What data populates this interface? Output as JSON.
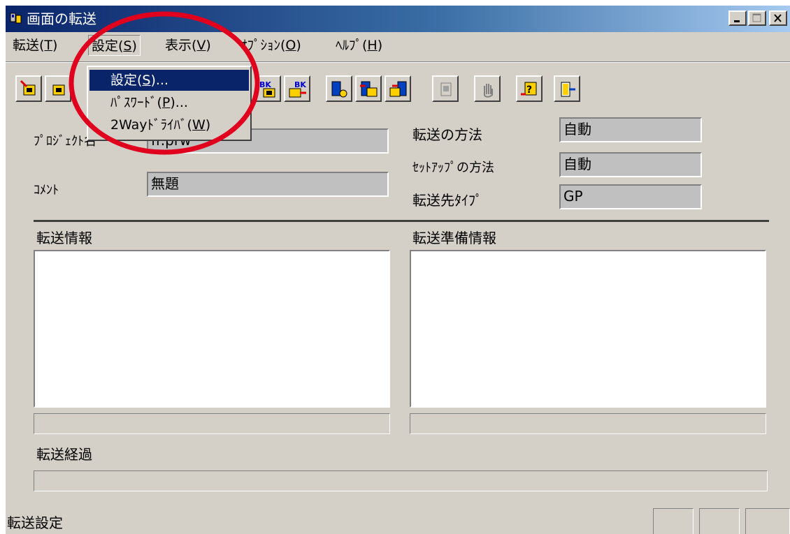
{
  "window": {
    "title": "画面の転送"
  },
  "menu": {
    "items": [
      {
        "label": "転送(",
        "key": "T",
        "tail": ")"
      },
      {
        "label": "設定(",
        "key": "S",
        "tail": ")"
      },
      {
        "label": "表示(",
        "key": "V",
        "tail": ")"
      },
      {
        "label": "ｵﾌﾟｼｮﾝ(",
        "key": "O",
        "tail": ")"
      },
      {
        "label": "ﾍﾙﾌﾟ(",
        "key": "H",
        "tail": ")"
      }
    ]
  },
  "dropdown": {
    "items": [
      {
        "label": "設定(",
        "key": "S",
        "tail": ")...",
        "selected": true
      },
      {
        "label": "ﾊﾟｽﾜｰﾄﾞ(",
        "key": "P",
        "tail": ")...",
        "selected": false
      },
      {
        "label": "2Wayﾄﾞﾗｲﾊﾞ(",
        "key": "W",
        "tail": ")",
        "selected": false
      }
    ]
  },
  "toolbar": {
    "buttons": [
      "send-icon",
      "send-receive-icon",
      "backup-icon",
      "backup-send-icon",
      "book-gear-icon",
      "book-send-icon",
      "book-receive-icon",
      "disabled-icon",
      "hand-icon",
      "help-icon",
      "exit-icon"
    ]
  },
  "fields": {
    "project_label": "ﾌﾟﾛｼﾞｪｸﾄ名",
    "project_value": "ff.prw",
    "comment_label": "ｺﾒﾝﾄ",
    "comment_value": "無題",
    "method_label": "転送の方法",
    "method_value": "自動",
    "setup_label": "ｾｯﾄｱｯﾌﾟの方法",
    "setup_value": "自動",
    "target_label": "転送先ﾀｲﾌﾟ",
    "target_value": "GP"
  },
  "panels": {
    "transfer_info": "転送情報",
    "prep_info": "転送準備情報",
    "progress": "転送経過"
  },
  "status": {
    "text": "転送設定"
  },
  "colors": {
    "titlebar_start": "#0a246a",
    "titlebar_end": "#a6caf0",
    "face": "#d4d0c8",
    "highlight": "#0a246a",
    "annotation": "#e0001e"
  }
}
